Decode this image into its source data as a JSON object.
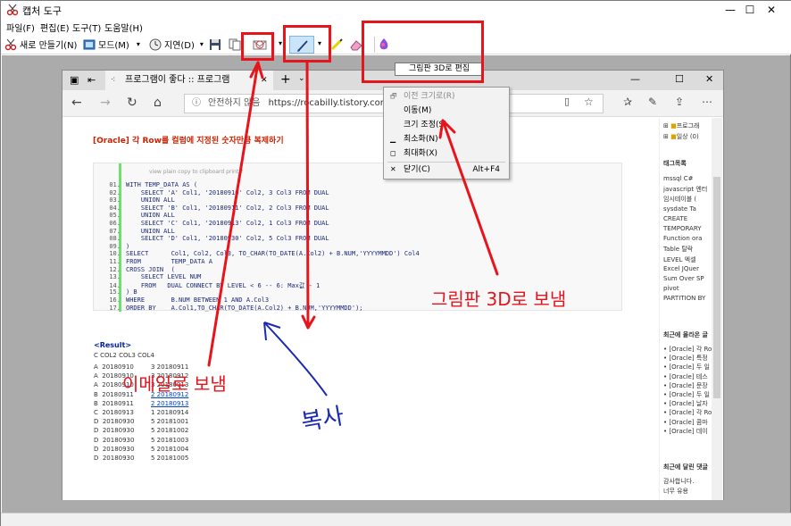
{
  "window": {
    "title": "캡처 도구",
    "min": "—",
    "max": "☐",
    "close": "✕"
  },
  "menu": [
    "파일(F)",
    "편집(E)",
    "도구(T)",
    "도움말(H)"
  ],
  "toolbar": {
    "new": "새로 만들기(N)",
    "mode": "모드(M)",
    "delay": "지연(D)"
  },
  "browser": {
    "tab_title": "프로그램이 좋다 :: 프로그램",
    "url_warning": "안전하지 않음",
    "url": "https://rocabilly.tistory.com/",
    "win_min": "—",
    "win_max": "☐",
    "win_close": "✕"
  },
  "post": {
    "title": "[Oracle] 각 Row를 컬럼에 지정된 숫자만큼 복제하기",
    "toolbar": "view plain   copy to clipboard   print   ?",
    "code": [
      {
        "n": "01.",
        "t": "WITH TEMP_DATA AS ("
      },
      {
        "n": "02.",
        "t": "    SELECT 'A' Col1, '20180910' Col2, 3 Col3 FROM DUAL"
      },
      {
        "n": "03.",
        "t": "    UNION ALL"
      },
      {
        "n": "04.",
        "t": "    SELECT 'B' Col1, '20180911' Col2, 2 Col3 FROM DUAL"
      },
      {
        "n": "05.",
        "t": "    UNION ALL"
      },
      {
        "n": "06.",
        "t": "    SELECT 'C' Col1, '20180913' Col2, 1 Col3 FROM DUAL"
      },
      {
        "n": "07.",
        "t": "    UNION ALL"
      },
      {
        "n": "08.",
        "t": "    SELECT 'D' Col1, '20180930' Col2, 5 Col3 FROM DUAL"
      },
      {
        "n": "09.",
        "t": ")"
      },
      {
        "n": "10.",
        "t": "SELECT      Col1, Col2, Col3, TO_CHAR(TO_DATE(A.Col2) + B.NUM,'YYYYMMDD') Col4"
      },
      {
        "n": "11.",
        "t": "FROM        TEMP_DATA A"
      },
      {
        "n": "12.",
        "t": "CROSS JOIN  ("
      },
      {
        "n": "13.",
        "t": "    SELECT LEVEL NUM"
      },
      {
        "n": "14.",
        "t": "    FROM   DUAL CONNECT BY LEVEL < 6 -- 6: Max값 - 1"
      },
      {
        "n": "15.",
        "t": ") B"
      },
      {
        "n": "16.",
        "t": "WHERE       B.NUM BETWEEN 1 AND A.Col3"
      },
      {
        "n": "17.",
        "t": "ORDER BY    A.Col1,TO_CHAR(TO_DATE(A.Col2) + B.NUM,'YYYYMMDD');"
      }
    ],
    "result_head": "<Result>",
    "result_cols": "C  COL2              COL3 COL4",
    "result_rows": [
      {
        "a": "A  20180910",
        "b": "3 20180911",
        "link": false
      },
      {
        "a": "A  20180910",
        "b": "3 20180912",
        "link": false
      },
      {
        "a": "A  20180910",
        "b": "3 20180913",
        "link": false
      },
      {
        "a": "B  20180911",
        "b": "2 20180912",
        "link": true
      },
      {
        "a": "B  20180911",
        "b": "2 20180913",
        "link": true
      },
      {
        "a": "C  20180913",
        "b": "1 20180914",
        "link": false
      },
      {
        "a": "D  20180930",
        "b": "5 20181001",
        "link": false
      },
      {
        "a": "D  20180930",
        "b": "5 20181002",
        "link": false
      },
      {
        "a": "D  20180930",
        "b": "5 20181003",
        "link": false
      },
      {
        "a": "D  20180930",
        "b": "5 20181004",
        "link": false
      },
      {
        "a": "D  20180930",
        "b": "5 20181005",
        "link": false
      }
    ]
  },
  "sidebar": {
    "tree": [
      "프로그래",
      "일상 (0)"
    ],
    "tag_head": "태그목록",
    "tags": [
      "mssql  C#",
      "javascript 엔터",
      "임시테이블  (",
      "sysdate   Ta",
      "CREATE",
      "TEMPORARY",
      "Function  ora",
      "Table  탈락  ",
      "LEVEL  엑셀",
      "Excel  JQuer",
      "Sum Over  SP",
      "pivot",
      "PARTITION BY"
    ],
    "recent_head": "최근에 올라온 글",
    "recent": [
      "[Oracle] 각 Ro",
      "[Oracle] 특정",
      "[Oracle] 두 일",
      "[Oracle] 테스",
      "[Oracle] 문장",
      "[Oracle] 두 일",
      "[Oracle] 날자",
      "[Oracle] 각 Ro",
      "[Oracle] 콤마",
      "[Oracle] 데이"
    ],
    "comments_head": "최근에 달린 댓글",
    "comments": [
      "감사합니다. ",
      "너무 유용 "
    ]
  },
  "context_menu": [
    {
      "label": "이전 크기로(R)",
      "shortcut": "",
      "glyph": "🗗",
      "disabled": true
    },
    {
      "label": "이동(M)",
      "shortcut": "",
      "glyph": "",
      "disabled": false
    },
    {
      "label": "크기 조정(S)",
      "shortcut": "",
      "glyph": "",
      "disabled": false
    },
    {
      "label": "최소화(N)",
      "shortcut": "",
      "glyph": "▁",
      "disabled": false
    },
    {
      "label": "최대화(X)",
      "shortcut": "",
      "glyph": "◻",
      "disabled": false
    },
    {
      "label": "닫기(C)",
      "shortcut": "Alt+F4",
      "glyph": "✕",
      "disabled": false
    }
  ],
  "tooltip": "그림판 3D로 편집",
  "annotations": {
    "email": "이메일로 보냄",
    "paint3d": "그림판 3D로 보냄",
    "copy": "복사"
  },
  "colors": {
    "annotation": "#e8141b",
    "accent": "#0066cc",
    "post_title": "#cc2200"
  }
}
